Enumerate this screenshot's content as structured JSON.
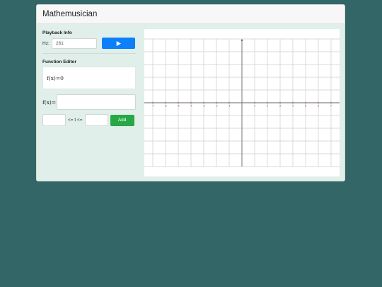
{
  "app": {
    "title": "Mathemusician"
  },
  "playback": {
    "section_label": "Playback Info",
    "hz_label": "Hz:",
    "hz_value": "261",
    "play_icon": "play-icon"
  },
  "editor": {
    "section_label": "Function Editor",
    "current_function": "f(x)=0",
    "input_label": "f(x)=",
    "input_value": "",
    "range_from_value": "",
    "range_label": "<= t <=",
    "range_to_value": "",
    "add_label": "Add"
  },
  "graph": {
    "x_ticks": [
      "-7",
      "-6",
      "-5",
      "-4",
      "-3",
      "-2",
      "-1",
      "1",
      "2",
      "3",
      "4",
      "5",
      "6",
      "7"
    ],
    "tick_color": "#cc3333",
    "axis_color": "#666666",
    "grid_color": "#cccccc"
  },
  "colors": {
    "background": "#336666",
    "panel": "#e0efe9",
    "primary": "#0d7ffb",
    "success": "#27a745"
  }
}
